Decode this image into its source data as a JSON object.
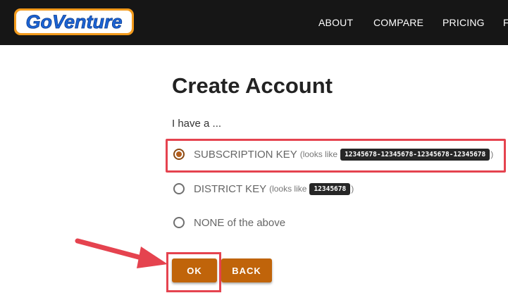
{
  "header": {
    "logo_text": "GoVenture",
    "nav": [
      "ABOUT",
      "COMPARE",
      "PRICING",
      "F"
    ]
  },
  "main": {
    "title": "Create Account",
    "prompt": "I have a ...",
    "options": [
      {
        "label": "SUBSCRIPTION KEY",
        "hint_prefix": "(looks like",
        "hint_code": "12345678-12345678-12345678-12345678",
        "hint_suffix": ")",
        "selected": true
      },
      {
        "label": "DISTRICT KEY",
        "hint_prefix": "(looks like",
        "hint_code": "12345678",
        "hint_suffix": ")",
        "selected": false
      },
      {
        "label": "NONE of the above",
        "selected": false
      }
    ],
    "buttons": {
      "ok": "OK",
      "back": "BACK"
    }
  },
  "colors": {
    "header_bg": "#161616",
    "button_bg": "#c0640a",
    "annotation_red": "#e5434f",
    "radio_selected": "#b35e1c",
    "logo_blue": "#1c64d6",
    "logo_orange": "#f29a1c"
  },
  "icons": {
    "annotation_arrow": "arrow-right-icon",
    "radio_on": "radio-checked-icon",
    "radio_off": "radio-unchecked-icon"
  }
}
